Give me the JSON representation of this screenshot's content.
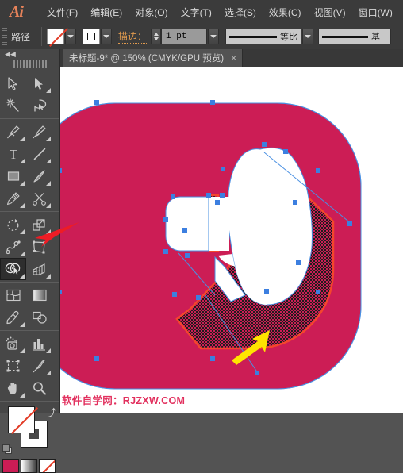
{
  "app": {
    "logo": "Ai",
    "accent_orange": "#e8835a",
    "chrome_bg": "#3b3b3b",
    "panel_bg": "#474747",
    "canvas_bg": "#ffffff"
  },
  "menubar": {
    "items": [
      {
        "label": "文件(F)",
        "name": "menu-file"
      },
      {
        "label": "编辑(E)",
        "name": "menu-edit"
      },
      {
        "label": "对象(O)",
        "name": "menu-object"
      },
      {
        "label": "文字(T)",
        "name": "menu-type"
      },
      {
        "label": "选择(S)",
        "name": "menu-select"
      },
      {
        "label": "效果(C)",
        "name": "menu-effect"
      },
      {
        "label": "视图(V)",
        "name": "menu-view"
      },
      {
        "label": "窗口(W)",
        "name": "menu-window"
      }
    ]
  },
  "controlbar": {
    "context_label": "路径",
    "fill_value": "无",
    "stroke_swatch_value": "白色",
    "stroke_label": "描边：",
    "stroke_weight": "1 pt",
    "profile_label": "等比",
    "profile2_label": "基",
    "stroke_accent": "#e09a4e"
  },
  "tabbar": {
    "tab_title": "未标题-9* @ 150% (CMYK/GPU 预览)",
    "close_glyph": "×"
  },
  "toolbar": {
    "collapse_glyph": "◀◀",
    "tools": [
      {
        "name": "tool-selection",
        "label": "选择工具",
        "icon": "cursor-arrow-icon",
        "has_flyout": false,
        "selected": false
      },
      {
        "name": "tool-direct-selection",
        "label": "直接选择工具",
        "icon": "direct-cursor-icon",
        "has_flyout": true,
        "selected": false
      },
      {
        "name": "tool-magic-wand",
        "label": "魔棒工具",
        "icon": "magic-wand-icon",
        "has_flyout": false,
        "selected": false
      },
      {
        "name": "tool-lasso",
        "label": "套索工具",
        "icon": "lasso-icon",
        "has_flyout": false,
        "selected": false
      },
      {
        "name": "tool-pen",
        "label": "钢笔工具",
        "icon": "pen-nib-icon",
        "has_flyout": true,
        "selected": false
      },
      {
        "name": "tool-curvature",
        "label": "曲率工具",
        "icon": "curvature-pen-icon",
        "has_flyout": true,
        "selected": false
      },
      {
        "name": "tool-type",
        "label": "文字工具",
        "icon": "type-t-icon",
        "has_flyout": true,
        "selected": false
      },
      {
        "name": "tool-line-segment",
        "label": "直线段工具",
        "icon": "line-segment-icon",
        "has_flyout": true,
        "selected": false
      },
      {
        "name": "tool-rectangle",
        "label": "矩形工具",
        "icon": "rectangle-icon",
        "has_flyout": true,
        "selected": false
      },
      {
        "name": "tool-paintbrush",
        "label": "画笔工具",
        "icon": "paintbrush-icon",
        "has_flyout": true,
        "selected": false
      },
      {
        "name": "tool-pencil",
        "label": "铅笔工具",
        "icon": "pencil-icon",
        "has_flyout": true,
        "selected": false
      },
      {
        "name": "tool-scissors",
        "label": "剪刀工具",
        "icon": "scissors-icon",
        "has_flyout": true,
        "selected": false
      },
      {
        "name": "tool-rotate",
        "label": "旋转工具",
        "icon": "rotate-icon",
        "has_flyout": true,
        "selected": false
      },
      {
        "name": "tool-scale",
        "label": "比例缩放工具",
        "icon": "scale-icon",
        "has_flyout": true,
        "selected": false
      },
      {
        "name": "tool-width",
        "label": "宽度工具",
        "icon": "width-warp-icon",
        "has_flyout": true,
        "selected": false
      },
      {
        "name": "tool-free-transform",
        "label": "自由变换工具",
        "icon": "free-transform-icon",
        "has_flyout": false,
        "selected": false
      },
      {
        "name": "tool-shape-builder",
        "label": "形状生成器工具",
        "icon": "shape-builder-icon",
        "has_flyout": true,
        "selected": true
      },
      {
        "name": "tool-perspective-grid",
        "label": "透视网格工具",
        "icon": "perspective-grid-icon",
        "has_flyout": true,
        "selected": false
      },
      {
        "name": "tool-mesh",
        "label": "网格工具",
        "icon": "mesh-icon",
        "has_flyout": false,
        "selected": false
      },
      {
        "name": "tool-gradient",
        "label": "渐变工具",
        "icon": "gradient-icon",
        "has_flyout": false,
        "selected": false
      },
      {
        "name": "tool-eyedropper",
        "label": "吸管工具",
        "icon": "eyedropper-icon",
        "has_flyout": true,
        "selected": false
      },
      {
        "name": "tool-blend",
        "label": "混合工具",
        "icon": "blend-icon",
        "has_flyout": false,
        "selected": false
      },
      {
        "name": "tool-symbol-sprayer",
        "label": "符号喷枪工具",
        "icon": "symbol-sprayer-icon",
        "has_flyout": true,
        "selected": false
      },
      {
        "name": "tool-column-graph",
        "label": "柱形图工具",
        "icon": "bar-chart-icon",
        "has_flyout": true,
        "selected": false
      },
      {
        "name": "tool-artboard",
        "label": "画板工具",
        "icon": "artboard-icon",
        "has_flyout": false,
        "selected": false
      },
      {
        "name": "tool-slice",
        "label": "切片工具",
        "icon": "slice-knife-icon",
        "has_flyout": true,
        "selected": false
      },
      {
        "name": "tool-hand",
        "label": "抓手工具",
        "icon": "hand-icon",
        "has_flyout": true,
        "selected": false
      },
      {
        "name": "tool-zoom",
        "label": "缩放工具",
        "icon": "magnifier-icon",
        "has_flyout": false,
        "selected": false
      }
    ],
    "fill_stroke": {
      "fill_label": "填色",
      "fill_is_none": true,
      "stroke_label": "描边",
      "stroke_is_none": false,
      "swap_glyph": "⤴",
      "default_label": "默认填色和描边"
    },
    "color_modes": [
      {
        "name": "mode-color",
        "label": "颜色",
        "color": "#cc1d55"
      },
      {
        "name": "mode-gradient",
        "label": "渐变",
        "color": "gradient"
      },
      {
        "name": "mode-none",
        "label": "无",
        "color": "#ffffff"
      }
    ]
  },
  "artwork": {
    "title": "扩音器图标路径",
    "shape_fill": "#cc1d55",
    "megaphone_fill": "#ffffff",
    "selection_stroke": "#4a90e2",
    "anchor_color": "#3c7fe0",
    "highlight_stroke": "#f4462c",
    "highlight_hatch": "#2a2a2a",
    "selected_region_label": "形状生成器高亮区域"
  },
  "annotations": {
    "red_arrow_label": "指向形状生成器工具",
    "red_arrow_color": "#ee1c25",
    "yellow_arrow_label": "指向高亮合并区域",
    "yellow_arrow_color": "#ffe400"
  },
  "watermark": {
    "text": "软件自学网：RJZXW.COM",
    "color": "#e2305e"
  }
}
